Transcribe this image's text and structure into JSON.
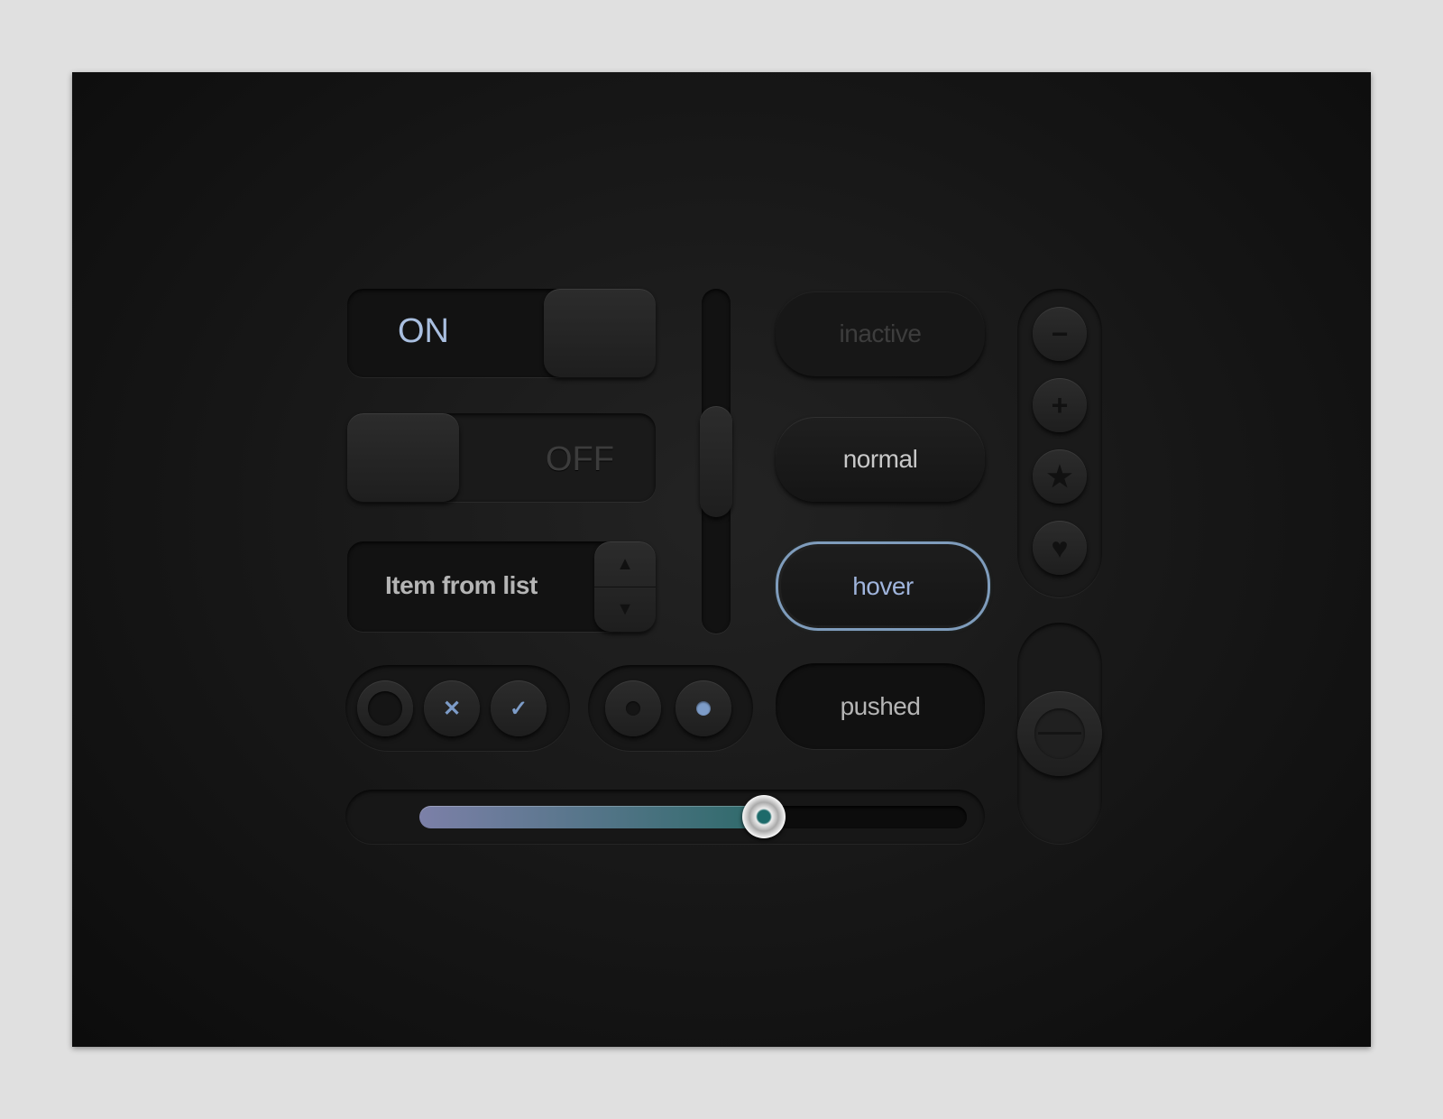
{
  "toggles": [
    {
      "label": "ON",
      "state": "on",
      "color": "#a9bfe0"
    },
    {
      "label": "OFF",
      "state": "off",
      "color": "#3a3a3a"
    }
  ],
  "select": {
    "value": "Item from list",
    "up_icon": "triangle-up",
    "down_icon": "triangle-down"
  },
  "scrollbar": {
    "position_fraction": 0.5
  },
  "buttons": [
    {
      "label": "inactive",
      "state": "inactive"
    },
    {
      "label": "normal",
      "state": "normal"
    },
    {
      "label": "hover",
      "state": "hover"
    },
    {
      "label": "pushed",
      "state": "pushed"
    }
  ],
  "icon_buttons": [
    {
      "icon": "minus-icon",
      "glyph": "−"
    },
    {
      "icon": "plus-icon",
      "glyph": "+"
    },
    {
      "icon": "star-icon",
      "glyph": "★"
    },
    {
      "icon": "heart-icon",
      "glyph": "♥"
    }
  ],
  "checkboxes": [
    {
      "state": "empty",
      "glyph": ""
    },
    {
      "state": "x",
      "glyph": "✕"
    },
    {
      "state": "check",
      "glyph": "✓"
    }
  ],
  "radios": [
    {
      "selected": false
    },
    {
      "selected": true
    }
  ],
  "slider": {
    "value_percent": 63
  },
  "vertical_slider": {
    "value_fraction": 0.5
  },
  "colors": {
    "accent": "#7d9cc8",
    "hover_border_start": "#8d8fc8",
    "hover_border_end": "#4fa8a8",
    "slider_fill_start": "#7c80a8",
    "slider_fill_end": "#2e6a6a"
  }
}
